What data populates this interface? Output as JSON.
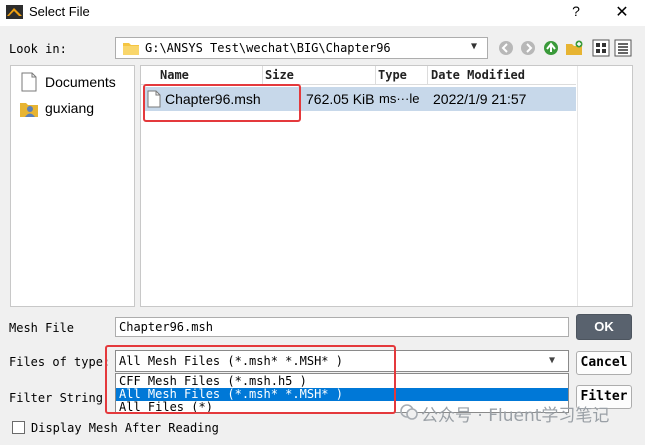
{
  "window": {
    "title": "Select File",
    "help_glyph": "?",
    "close_glyph": "✕"
  },
  "look_in": {
    "label": "Look in:",
    "path": "G:\\ANSYS Test\\wechat\\BIG\\Chapter96",
    "toolbar_icons": [
      "back-icon",
      "forward-icon",
      "parent-directory-icon",
      "new-folder-icon",
      "icon-view-icon",
      "detail-view-icon"
    ]
  },
  "sidebar": {
    "items": [
      {
        "label": "Documents",
        "icon": "document-icon"
      },
      {
        "label": "guxiang",
        "icon": "user-icon"
      }
    ]
  },
  "file_list": {
    "columns": [
      "Name",
      "Size",
      "Type",
      "Date Modified"
    ],
    "rows": [
      {
        "name": "Chapter96.msh",
        "size": "762.05 KiB",
        "type": "ms···le",
        "date": "2022/1/9 21:57",
        "selected": true
      }
    ]
  },
  "mesh_file": {
    "label": "Mesh File",
    "value": "Chapter96.msh"
  },
  "files_of_type": {
    "label": "Files of type:",
    "selected": "All Mesh Files (*.msh* *.MSH* )",
    "options": [
      "CFF Mesh Files (*.msh.h5 )",
      "All Mesh Files (*.msh* *.MSH* )",
      "All Files (*)"
    ],
    "highlighted_index": 1
  },
  "filter_string": {
    "label": "Filter String"
  },
  "buttons": {
    "ok": "OK",
    "cancel": "Cancel",
    "filter": "Filter"
  },
  "display_after_reading": {
    "label": "Display Mesh After Reading",
    "checked": false
  },
  "watermark": {
    "text": "公众号 · Fluent学习笔记"
  },
  "colors": {
    "selection_row": "#c7d8ea",
    "dropdown_selection": "#0078d7",
    "ok_button": "#59626e",
    "highlight_box": "#e4393c"
  }
}
